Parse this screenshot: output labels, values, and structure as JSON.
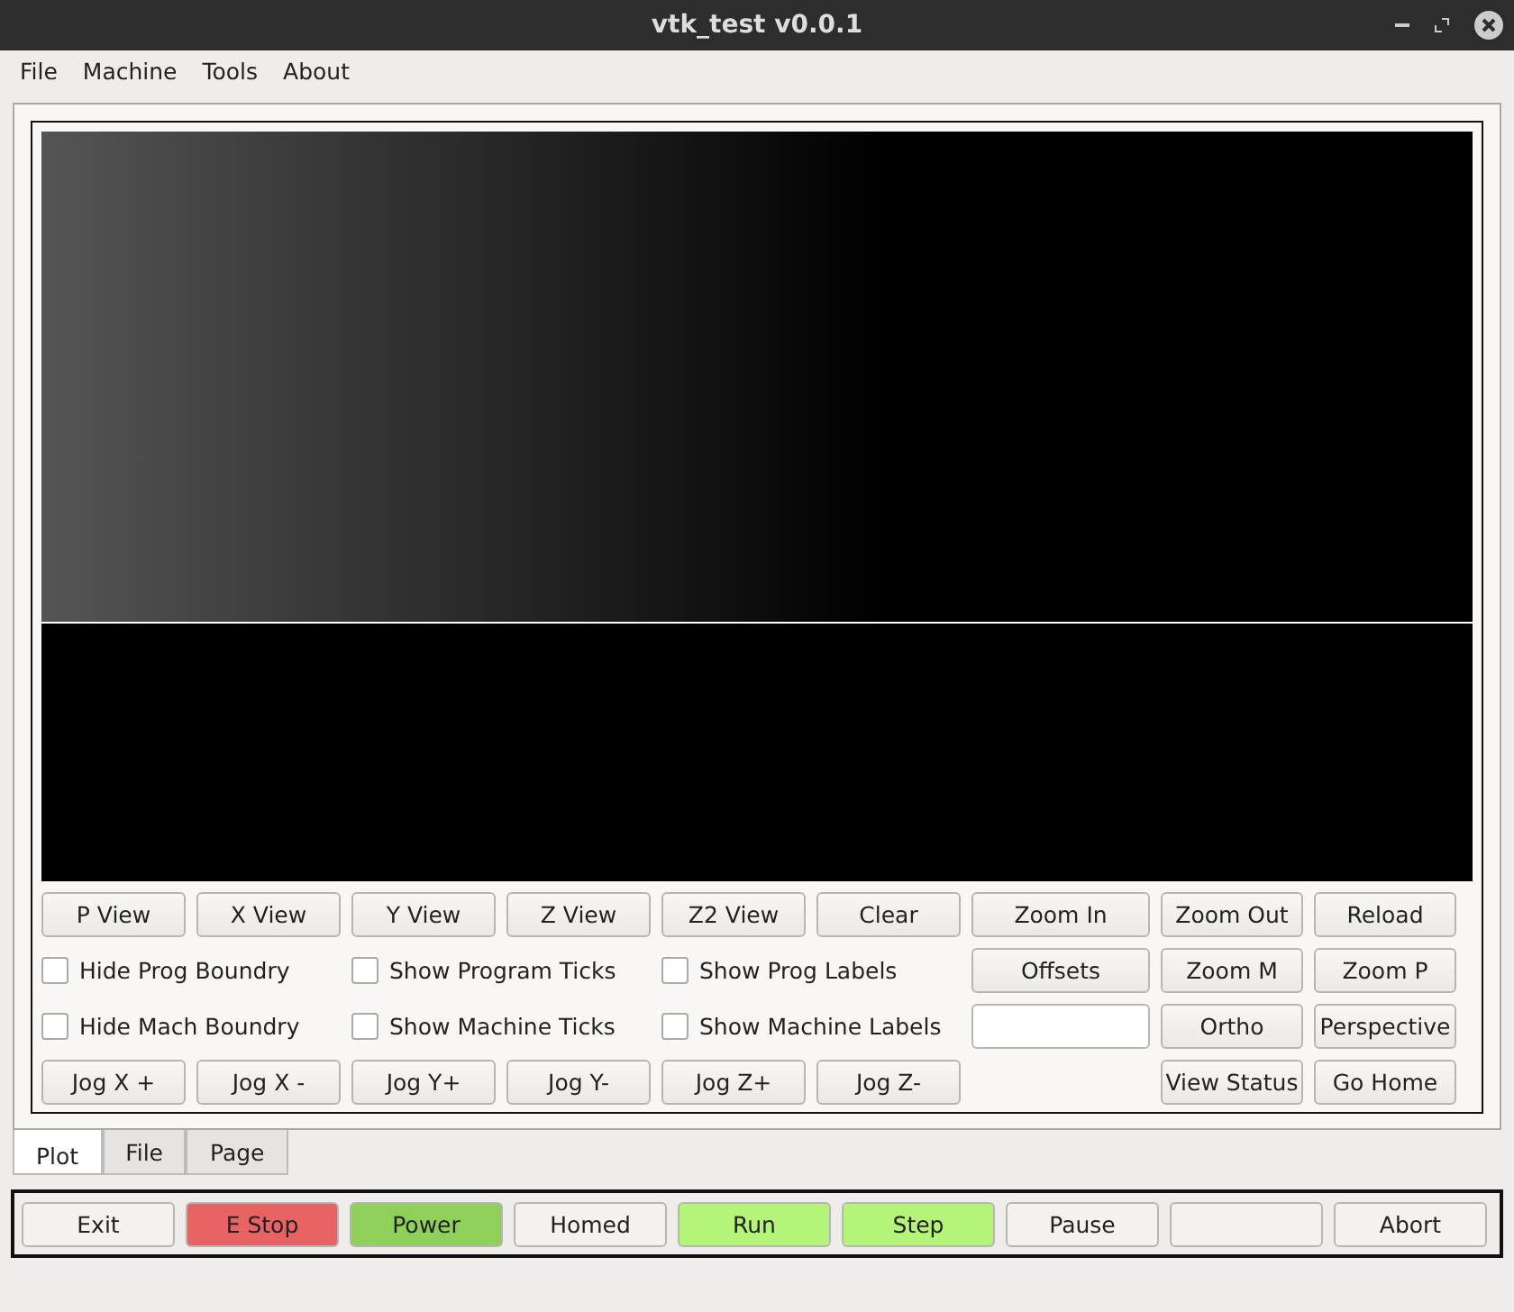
{
  "window": {
    "title": "vtk_test v0.0.1"
  },
  "menu": [
    "File",
    "Machine",
    "Tools",
    "About"
  ],
  "controls": [
    {
      "kind": "button",
      "label": "P View"
    },
    {
      "kind": "button",
      "label": "X View"
    },
    {
      "kind": "button",
      "label": "Y View"
    },
    {
      "kind": "button",
      "label": "Z View"
    },
    {
      "kind": "button",
      "label": "Z2 View"
    },
    {
      "kind": "button",
      "label": "Clear"
    },
    {
      "kind": "button",
      "label": "Zoom In"
    },
    {
      "kind": "button",
      "label": "Zoom Out"
    },
    {
      "kind": "button",
      "label": "Reload"
    },
    {
      "kind": "checkbox",
      "label": "Hide Prog Boundry",
      "checked": false
    },
    {
      "kind": "checkbox",
      "label": "Show Program Ticks",
      "checked": false
    },
    {
      "kind": "checkbox",
      "label": "Show Prog Labels",
      "checked": false
    },
    {
      "kind": "button",
      "label": "Offsets"
    },
    {
      "kind": "button",
      "label": "Zoom M"
    },
    {
      "kind": "button",
      "label": "Zoom P"
    },
    {
      "kind": "checkbox",
      "label": "Hide Mach Boundry",
      "checked": false
    },
    {
      "kind": "checkbox",
      "label": "Show Machine Ticks",
      "checked": false
    },
    {
      "kind": "checkbox",
      "label": "Show Machine Labels",
      "checked": false
    },
    {
      "kind": "field"
    },
    {
      "kind": "button",
      "label": "Ortho"
    },
    {
      "kind": "button",
      "label": "Perspective"
    },
    {
      "kind": "button",
      "label": "Jog X +"
    },
    {
      "kind": "button",
      "label": "Jog X -"
    },
    {
      "kind": "button",
      "label": "Jog Y+"
    },
    {
      "kind": "button",
      "label": "Jog Y-"
    },
    {
      "kind": "button",
      "label": "Jog Z+"
    },
    {
      "kind": "button",
      "label": "Jog Z-"
    },
    {
      "kind": "spacer"
    },
    {
      "kind": "button",
      "label": "View Status"
    },
    {
      "kind": "button",
      "label": "Go Home"
    }
  ],
  "tabs": [
    {
      "label": "Plot",
      "selected": true
    },
    {
      "label": "File",
      "selected": false
    },
    {
      "label": "Page",
      "selected": false
    }
  ],
  "bottom_buttons": [
    {
      "label": "Exit",
      "color": "#f3f2f0"
    },
    {
      "label": "E Stop",
      "color": "#e86464"
    },
    {
      "label": "Power",
      "color": "#8fd05a"
    },
    {
      "label": "Homed",
      "color": "#f3f2f0"
    },
    {
      "label": "Run",
      "color": "#b4f478"
    },
    {
      "label": "Step",
      "color": "#b4f478"
    },
    {
      "label": "Pause",
      "color": "#f3f2f0"
    },
    {
      "color": "#f3f2f0"
    },
    {
      "label": "Abort",
      "color": "#f3f2f0"
    }
  ]
}
